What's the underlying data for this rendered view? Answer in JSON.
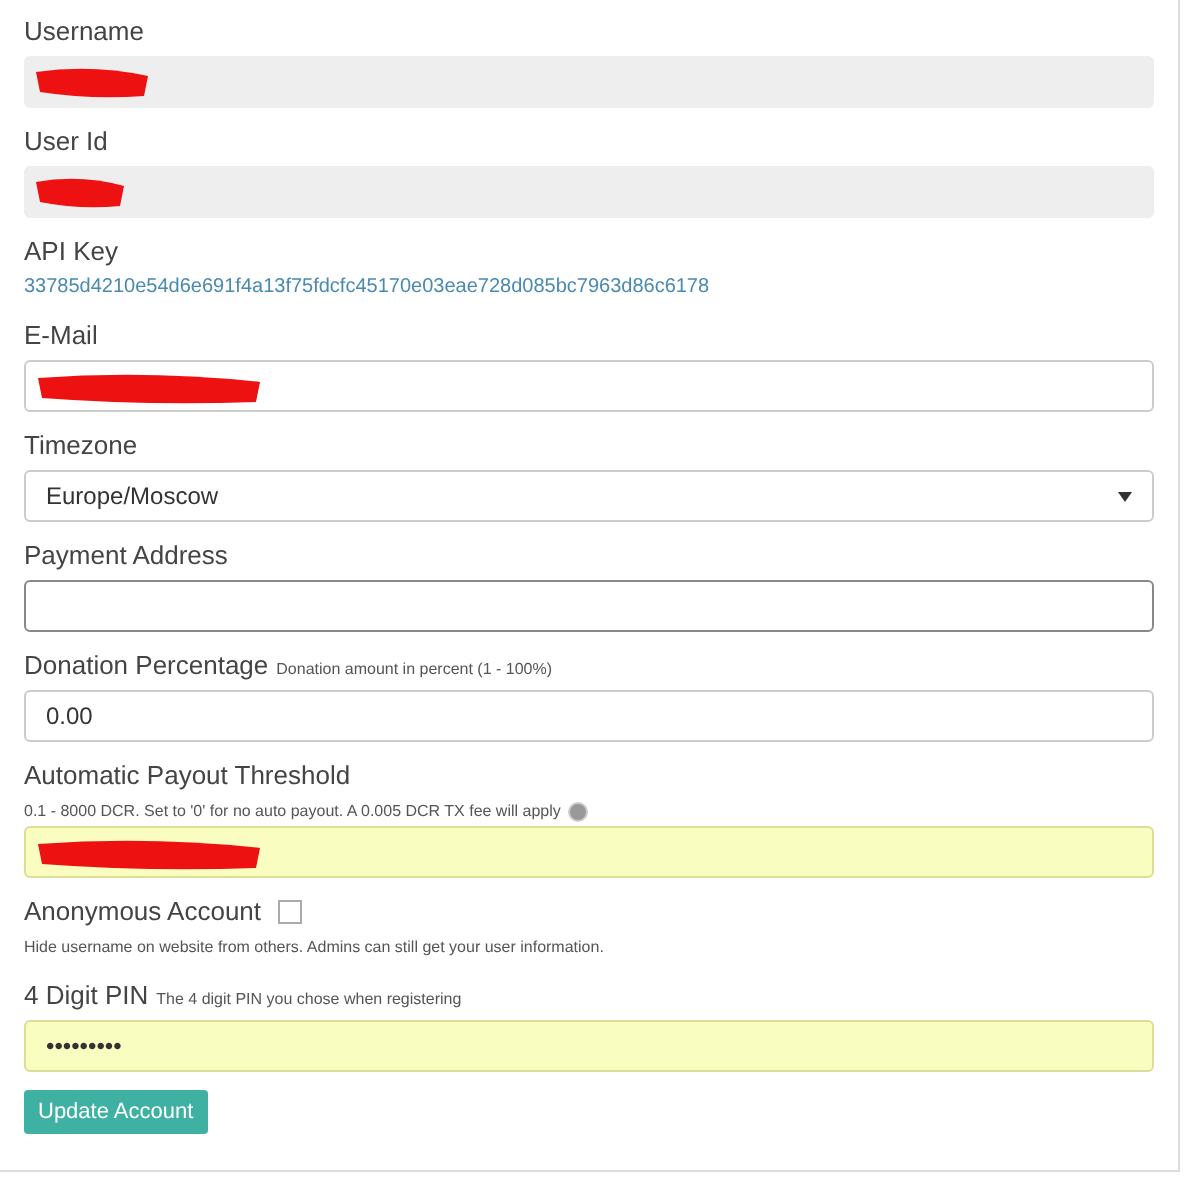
{
  "fields": [
    {
      "kind": "readonly",
      "label": "Username",
      "redacted": true
    },
    {
      "kind": "readonly",
      "label": "User Id",
      "redacted": true
    },
    {
      "kind": "plain",
      "label": "API Key",
      "value": "33785d4210e54d6e691f4a13f75fdcfc45170e03eae728d085bc7963d86c6178"
    },
    {
      "kind": "text",
      "label": "E-Mail",
      "redacted": true
    },
    {
      "kind": "select",
      "label": "Timezone",
      "value": "Europe/Moscow"
    },
    {
      "kind": "text",
      "label": "Payment Address"
    },
    {
      "kind": "text",
      "label": "Donation Percentage",
      "note": "Donation amount in percent (1 - 100%)",
      "value": "0.00"
    },
    {
      "kind": "text",
      "label": "Automatic Payout Threshold",
      "hint": "0.1 - 8000 DCR. Set to '0' for no auto payout. A 0.005 DCR TX fee will apply",
      "help_icon": true,
      "highlighted": true,
      "redacted": true
    },
    {
      "kind": "checkbox",
      "label": "Anonymous Account",
      "checked": false,
      "hint": "Hide username on website from others. Admins can still get your user information."
    },
    {
      "kind": "text",
      "label": "4 Digit PIN",
      "note": "The 4 digit PIN you chose when registering",
      "value": "•••••••••",
      "highlighted": true
    }
  ],
  "button": "Update Account"
}
